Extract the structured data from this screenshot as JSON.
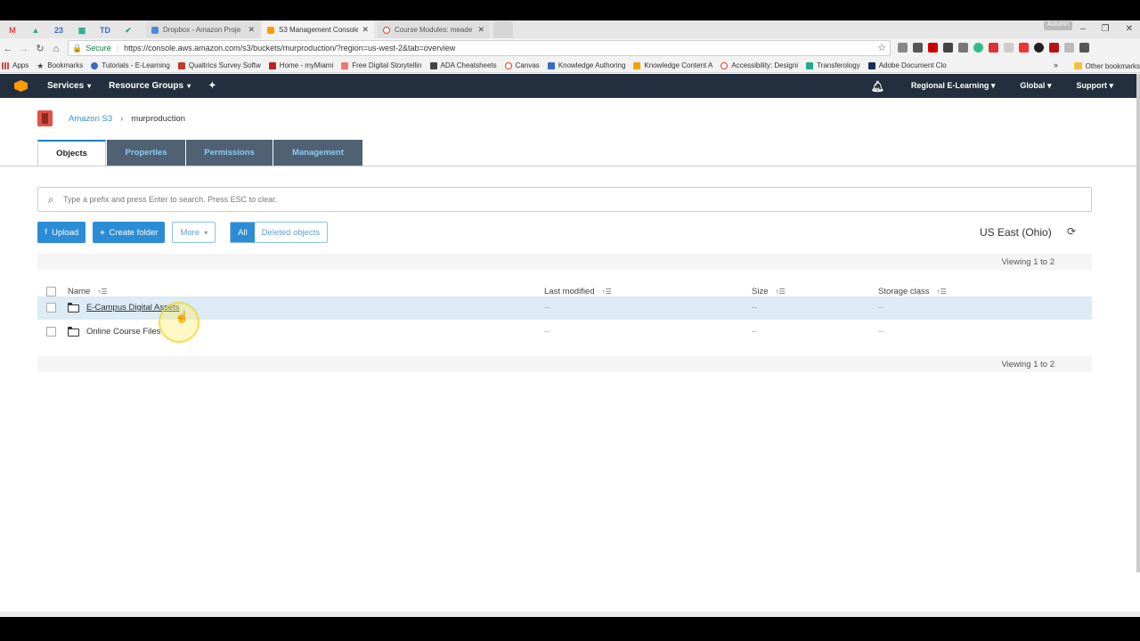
{
  "browser": {
    "tabs": [
      {
        "title": "Dropbox - Amazon Proje",
        "icon": "dropbox-icon",
        "color": "#4a88e0"
      },
      {
        "title": "S3 Management Console",
        "icon": "aws-icon",
        "color": "#f90"
      },
      {
        "title": "Course Modules: meade",
        "icon": "canvas-icon",
        "color": "#e23d2b"
      }
    ],
    "pinned_tabs": [
      "M",
      "▲",
      "23",
      "▦",
      "TD",
      "✔"
    ],
    "profile": "Autumn",
    "security_label": "Secure",
    "url": "https://console.aws.amazon.com/s3/buckets/murproduction/?region=us-west-2&tab=overview",
    "bookmarks": [
      {
        "label": "Apps",
        "color": "#c44"
      },
      {
        "label": "Bookmarks",
        "color": "#444"
      },
      {
        "label": "Tutorials - E-Learning",
        "color": "#3a6ac8"
      },
      {
        "label": "Qualtrics Survey Softw",
        "color": "#c0392b"
      },
      {
        "label": "Home - myMiami",
        "color": "#b22"
      },
      {
        "label": "Free Digital Storytellin",
        "color": "#e77"
      },
      {
        "label": "ADA Cheatsheets",
        "color": "#444"
      },
      {
        "label": "Canvas",
        "color": "#e23d2b"
      },
      {
        "label": "Knowledge Authoring",
        "color": "#3a6ac8"
      },
      {
        "label": "Knowledge Content A",
        "color": "#f0a500"
      },
      {
        "label": "Accessibility: Designi",
        "color": "#e23d2b"
      },
      {
        "label": "Transferology",
        "color": "#2a8"
      },
      {
        "label": "Adobe Document Clo",
        "color": "#1a2b5a"
      }
    ],
    "bookmarks_more": "»",
    "other_bookmarks": "Other bookmarks"
  },
  "awsnav": {
    "services": "Services",
    "resource_groups": "Resource Groups",
    "account": "Regional E-Learning",
    "region": "Global",
    "support": "Support"
  },
  "breadcrumb": {
    "root": "Amazon S3",
    "bucket": "murproduction"
  },
  "console_tabs": [
    "Objects",
    "Properties",
    "Permissions",
    "Management"
  ],
  "search_placeholder": "Type a prefix and press Enter to search. Press ESC to clear.",
  "actions": {
    "upload": "Upload",
    "create_folder": "Create folder",
    "more": "More",
    "filter_all": "All",
    "filter_deleted": "Deleted objects"
  },
  "region_label": "US East (Ohio)",
  "viewing": "Viewing 1 to 2",
  "columns": {
    "name": "Name",
    "last_modified": "Last modified",
    "size": "Size",
    "storage_class": "Storage class"
  },
  "rows": [
    {
      "name": "E-Campus Digital Assets",
      "last_modified": "--",
      "size": "--",
      "storage_class": "--"
    },
    {
      "name": "Online Course Files",
      "last_modified": "--",
      "size": "--",
      "storage_class": "--"
    }
  ]
}
